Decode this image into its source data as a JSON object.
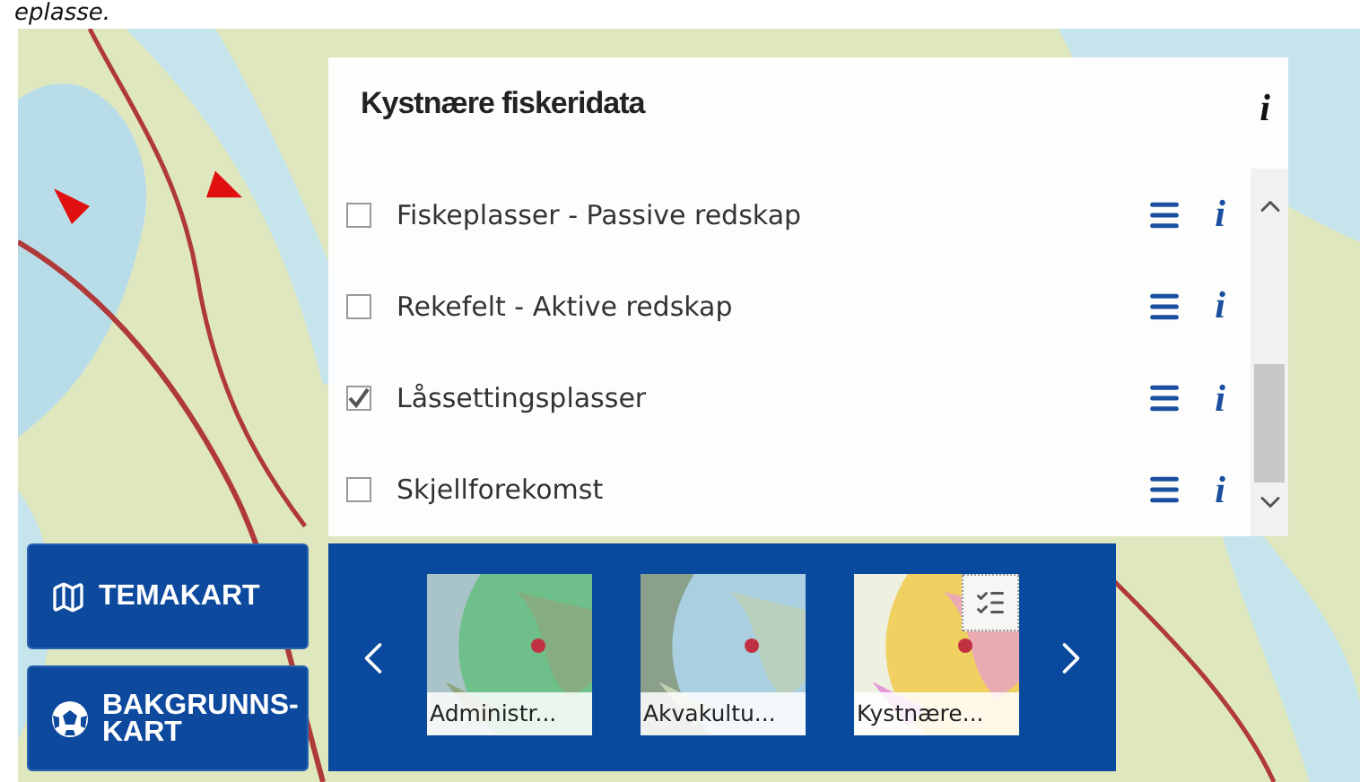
{
  "caption": "eplasse.",
  "panel": {
    "title": "Kystnære fiskeridata",
    "info": "i",
    "layers": [
      {
        "label": "Fiskeplasser - Passive redskap",
        "checked": false,
        "info": "i"
      },
      {
        "label": "Rekefelt - Aktive redskap",
        "checked": false,
        "info": "i"
      },
      {
        "label": "Låssettingsplasser",
        "checked": true,
        "info": "i"
      },
      {
        "label": "Skjellforekomst",
        "checked": false,
        "info": "i"
      }
    ]
  },
  "side_buttons": [
    {
      "label": "TEMAKART",
      "kind": "theme"
    },
    {
      "label": "BAKGRUNNS-KART",
      "kind": "background"
    }
  ],
  "carousel": {
    "items": [
      {
        "label": "Administr...",
        "kind": "green",
        "legend": false
      },
      {
        "label": "Akvakultu...",
        "kind": "water",
        "legend": false
      },
      {
        "label": "Kystnære...",
        "kind": "coast",
        "legend": true
      }
    ]
  }
}
